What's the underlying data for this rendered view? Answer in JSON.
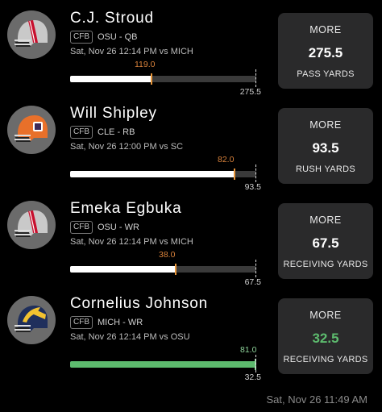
{
  "players": [
    {
      "name": "C.J. Stroud",
      "league": "CFB",
      "team_pos": "OSU - QB",
      "game": "Sat, Nov 26 12:14 PM  vs MICH",
      "current": "119.0",
      "line": "275.5",
      "progress": 0.432,
      "direction": "MORE",
      "stat": "PASS YARDS",
      "helmet": "osu-helmet-icon",
      "fill_color": "#ffffff"
    },
    {
      "name": "Will Shipley",
      "league": "CFB",
      "team_pos": "CLE - RB",
      "game": "Sat, Nov 26 12:00 PM  vs SC",
      "current": "82.0",
      "line": "93.5",
      "progress": 0.877,
      "direction": "MORE",
      "stat": "RUSH YARDS",
      "helmet": "clemson-helmet-icon",
      "fill_color": "#ffffff"
    },
    {
      "name": "Emeka Egbuka",
      "league": "CFB",
      "team_pos": "OSU - WR",
      "game": "Sat, Nov 26 12:14 PM  vs MICH",
      "current": "38.0",
      "line": "67.5",
      "progress": 0.563,
      "direction": "MORE",
      "stat": "RECEIVING YARDS",
      "helmet": "osu-helmet-icon",
      "fill_color": "#ffffff"
    },
    {
      "name": "Cornelius Johnson",
      "league": "CFB",
      "team_pos": "MICH - WR",
      "game": "Sat, Nov 26 12:14 PM  vs OSU",
      "current": "81.0",
      "line": "32.5",
      "progress": 1.0,
      "direction": "MORE",
      "stat": "RECEIVING YARDS",
      "helmet": "michigan-helmet-icon",
      "fill_color": "#5dbb6e"
    }
  ],
  "footer_time": "Sat, Nov 26 11:49 AM",
  "colors": {
    "accent_orange": "#e8963a",
    "hit_green": "#5dbb6e"
  }
}
